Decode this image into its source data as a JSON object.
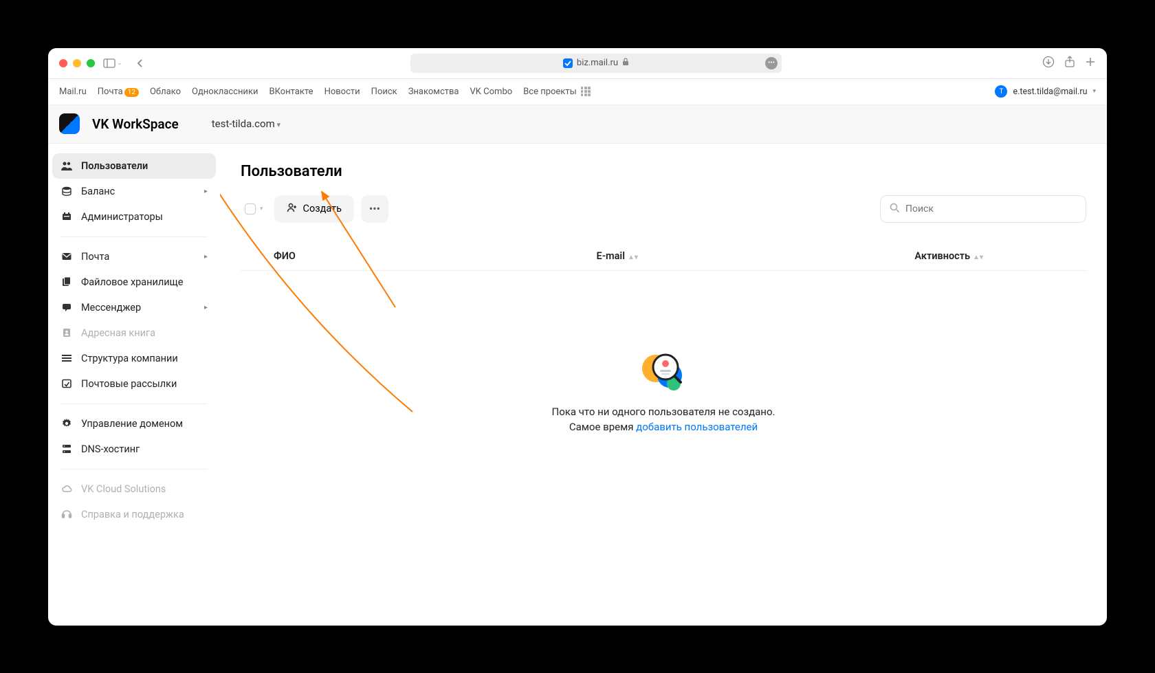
{
  "browser": {
    "url_host": "biz.mail.ru"
  },
  "topnav": {
    "items": [
      "Mail.ru",
      "Почта",
      "Облако",
      "Одноклассники",
      "ВКонтакте",
      "Новости",
      "Поиск",
      "Знакомства",
      "VK Combo",
      "Все проекты"
    ],
    "mail_badge": "12",
    "user_email": "e.test.tilda@mail.ru",
    "user_initial": "T"
  },
  "appbar": {
    "brand": "VK WorkSpace",
    "domain": "test-tilda.com"
  },
  "sidebar": {
    "items": [
      {
        "label": "Пользователи",
        "icon": "users",
        "active": true
      },
      {
        "label": "Баланс",
        "icon": "balance",
        "chev": true
      },
      {
        "label": "Администраторы",
        "icon": "admins"
      },
      {
        "sep": true
      },
      {
        "label": "Почта",
        "icon": "mail",
        "chev": true
      },
      {
        "label": "Файловое хранилище",
        "icon": "files"
      },
      {
        "label": "Мессенджер",
        "icon": "messenger",
        "chev": true
      },
      {
        "label": "Адресная книга",
        "icon": "contacts",
        "disabled": true
      },
      {
        "label": "Структура компании",
        "icon": "org"
      },
      {
        "label": "Почтовые рассылки",
        "icon": "newsletter"
      },
      {
        "sep": true
      },
      {
        "label": "Управление доменом",
        "icon": "gear"
      },
      {
        "label": "DNS-хостинг",
        "icon": "dns"
      },
      {
        "sep": true
      },
      {
        "label": "VK Cloud Solutions",
        "icon": "cloud",
        "disabled": true
      },
      {
        "label": "Справка и поддержка",
        "icon": "help",
        "disabled": true
      }
    ]
  },
  "page": {
    "title": "Пользователи",
    "create_label": "Создать",
    "search_placeholder": "Поиск",
    "cols": {
      "fio": "ФИО",
      "email": "E-mail",
      "activity": "Активность"
    },
    "empty_line1": "Пока что ни одного пользователя не создано.",
    "empty_line2_a": "Самое время ",
    "empty_link": "добавить пользователей"
  }
}
